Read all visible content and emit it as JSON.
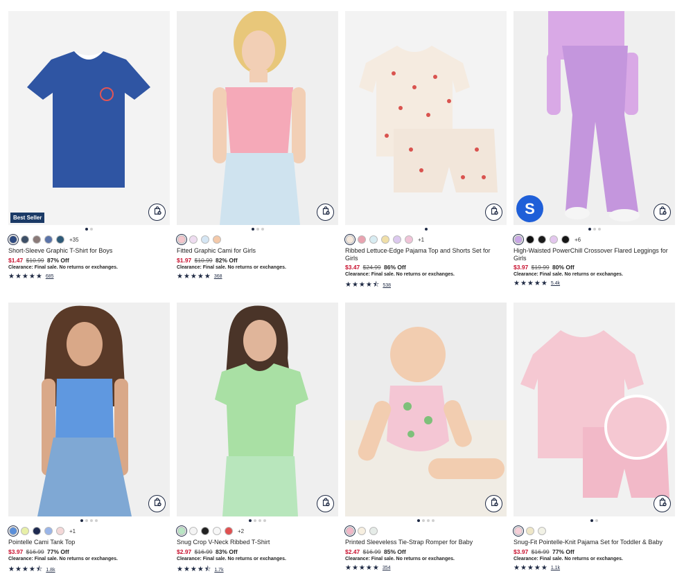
{
  "products": [
    {
      "name": "Short-Sleeve Graphic T-Shirt for Boys",
      "sale": "$1.47",
      "orig": "$10.99",
      "pct": "87% Off",
      "clearance": "Clearance: Final sale. No returns or exchanges.",
      "reviews": "685",
      "rating": 5,
      "more": "+35",
      "badge": "Best Seller",
      "swatches": [
        "#2e4a80",
        "#3d4f66",
        "#8a7a78",
        "#5a73a8",
        "#2e5a78"
      ],
      "dots": [
        1,
        0
      ]
    },
    {
      "name": "Fitted Graphic Cami for Girls",
      "sale": "$1.97",
      "orig": "$10.99",
      "pct": "82% Off",
      "clearance": "Clearance: Final sale. No returns or exchanges.",
      "reviews": "368",
      "rating": 5,
      "more": "",
      "swatches": [
        "#f4c6cc",
        "#eedcf0",
        "#d5e6f4",
        "#f4c9a9"
      ],
      "dots": [
        1,
        0,
        0
      ]
    },
    {
      "name": "Ribbed Lettuce-Edge Pajama Top and Shorts Set for Girls",
      "sale": "$3.47",
      "orig": "$24.99",
      "pct": "86% Off",
      "clearance": "Clearance: Final sale. No returns or exchanges.",
      "reviews": "538",
      "rating": 4.5,
      "more": "+1",
      "swatches": [
        "#f5e8dc",
        "#e9a3b0",
        "#d8ecf2",
        "#f0dfa8",
        "#dcc9ef",
        "#f0c4d8"
      ],
      "dots": [
        1
      ]
    },
    {
      "name": "High-Waisted PowerChill Crossover Flared Leggings for Girls",
      "sale": "$3.97",
      "orig": "$19.99",
      "pct": "80% Off",
      "clearance": "Clearance: Final sale. No returns or exchanges.",
      "reviews": "5.4k",
      "rating": 5,
      "more": "+6",
      "logo": "S",
      "swatches": [
        "#c9a6e6",
        "#111111",
        "#1a1a1a",
        "#e3c7ee",
        "#161616"
      ],
      "dots": [
        1,
        0,
        0
      ]
    },
    {
      "name": "Pointelle Cami Tank Top",
      "sale": "$3.97",
      "orig": "$16.99",
      "pct": "77% Off",
      "clearance": "Clearance: Final sale. No returns or exchanges.",
      "reviews": "1.8k",
      "rating": 4.5,
      "more": "+1",
      "swatches": [
        "#5b8fd9",
        "#e8f0a8",
        "#1e2a50",
        "#9ab5e8",
        "#f4d8d8"
      ],
      "dots": [
        1,
        0,
        0,
        0
      ]
    },
    {
      "name": "Snug Crop V-Neck Ribbed T-Shirt",
      "sale": "$2.97",
      "orig": "$16.99",
      "pct": "83% Off",
      "clearance": "Clearance: Final sale. No returns or exchanges.",
      "reviews": "1.7k",
      "rating": 4.5,
      "more": "+2",
      "swatches": [
        "#b9e6c4",
        "#f4f4f4",
        "#222222",
        "#f7f7f7",
        "#e05050"
      ],
      "dots": [
        1,
        0,
        0,
        0
      ]
    },
    {
      "name": "Printed Sleeveless Tie-Strap Romper for Baby",
      "sale": "$2.47",
      "orig": "$16.99",
      "pct": "85% Off",
      "clearance": "Clearance: Final sale. No returns or exchanges.",
      "reviews": "354",
      "rating": 5,
      "more": "",
      "swatches": [
        "#f2b8c8",
        "#f7efe0",
        "#e6ece8"
      ],
      "dots": [
        1,
        0,
        0,
        0
      ]
    },
    {
      "name": "Snug-Fit Pointelle-Knit Pajama Set for Toddler & Baby",
      "sale": "$3.97",
      "orig": "$16.99",
      "pct": "77% Off",
      "clearance": "Clearance: Final sale. No returns or exchanges.",
      "reviews": "1.1k",
      "rating": 5,
      "more": "",
      "swatches": [
        "#f6cfd8",
        "#efe7c8",
        "#f2f2e6"
      ],
      "dots": [
        1,
        0
      ]
    }
  ]
}
